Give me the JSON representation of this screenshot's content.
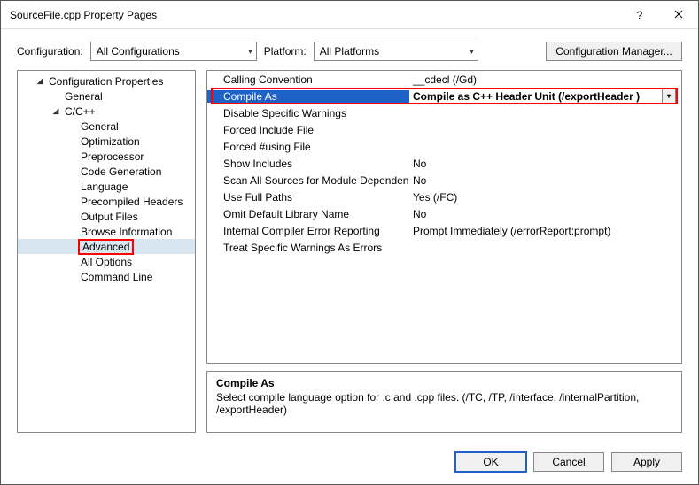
{
  "window": {
    "title": "SourceFile.cpp Property Pages"
  },
  "config": {
    "configuration_label": "Configuration:",
    "configuration_value": "All Configurations",
    "platform_label": "Platform:",
    "platform_value": "All Platforms",
    "manager_button": "Configuration Manager..."
  },
  "tree": {
    "root": "Configuration Properties",
    "items": [
      "General",
      "C/C++"
    ],
    "cpp_children": [
      "General",
      "Optimization",
      "Preprocessor",
      "Code Generation",
      "Language",
      "Precompiled Headers",
      "Output Files",
      "Browse Information",
      "Advanced",
      "All Options",
      "Command Line"
    ],
    "selected": "Advanced"
  },
  "grid": {
    "rows": [
      {
        "name": "Calling Convention",
        "value": "__cdecl (/Gd)"
      },
      {
        "name": "Compile As",
        "value": "Compile as C++ Header Unit (/exportHeader )",
        "selected": true
      },
      {
        "name": "Disable Specific Warnings",
        "value": ""
      },
      {
        "name": "Forced Include File",
        "value": ""
      },
      {
        "name": "Forced #using File",
        "value": ""
      },
      {
        "name": "Show Includes",
        "value": "No"
      },
      {
        "name": "Scan All Sources for Module Dependencies",
        "value": "No"
      },
      {
        "name": "Use Full Paths",
        "value": "Yes (/FC)"
      },
      {
        "name": "Omit Default Library Name",
        "value": "No"
      },
      {
        "name": "Internal Compiler Error Reporting",
        "value": "Prompt Immediately (/errorReport:prompt)"
      },
      {
        "name": "Treat Specific Warnings As Errors",
        "value": ""
      }
    ]
  },
  "description": {
    "heading": "Compile As",
    "body": "Select compile language option for .c and .cpp files.     (/TC, /TP, /interface, /internalPartition, /exportHeader)"
  },
  "buttons": {
    "ok": "OK",
    "cancel": "Cancel",
    "apply": "Apply"
  }
}
